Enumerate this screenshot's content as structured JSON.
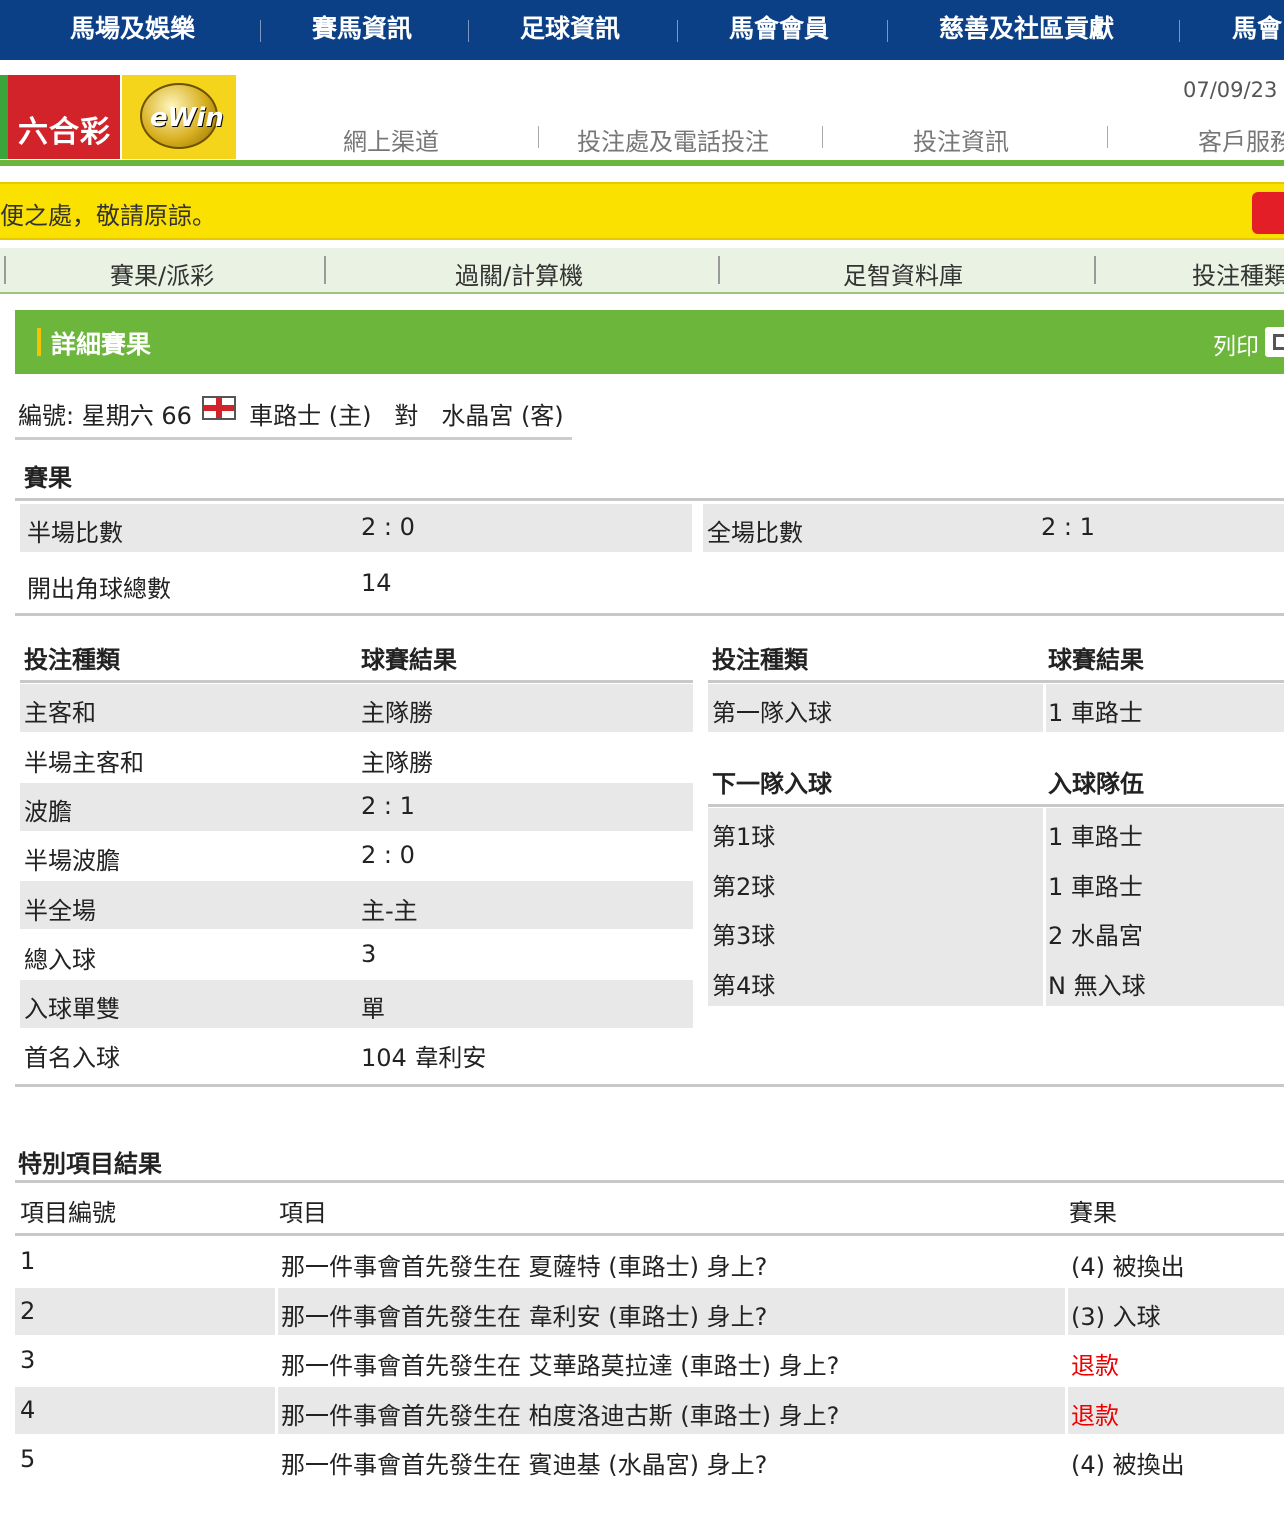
{
  "top_nav": [
    "馬場及娛樂",
    "賽馬資訊",
    "足球資訊",
    "馬會會員",
    "慈善及社區貢獻",
    "馬會"
  ],
  "header": {
    "logo_marksix": "六合彩",
    "logo_ewin": "eWin",
    "date": "07/09/23",
    "sub_nav": [
      "網上渠道",
      "投注處及電話投注",
      "投注資訊",
      "客戶服務"
    ]
  },
  "notice": "便之處，敬請原諒。",
  "tabs": [
    "賽果/派彩",
    "過關/計算機",
    "足智資料庫",
    "投注種類"
  ],
  "section": {
    "title": "詳細賽果",
    "print_label": "列印"
  },
  "match": {
    "prefix": "編號: 星期六 66",
    "home": "車路士 (主)",
    "vs": "對",
    "away": "水晶宮 (客)"
  },
  "results": {
    "heading": "賽果",
    "half_time_label": "半場比數",
    "half_time_score": "2 : 0",
    "full_time_label": "全場比數",
    "full_time_score": "2 : 1",
    "corners_label": "開出角球總數",
    "corners_value": "14"
  },
  "bet_table": {
    "col_type": "投注種類",
    "col_result": "球賽結果",
    "rows": [
      {
        "type": "主客和",
        "result": "主隊勝"
      },
      {
        "type": "半場主客和",
        "result": "主隊勝"
      },
      {
        "type": "波膽",
        "result": "2 : 1"
      },
      {
        "type": "半場波膽",
        "result": "2 : 0"
      },
      {
        "type": "半全場",
        "result": "主-主"
      },
      {
        "type": "總入球",
        "result": "3"
      },
      {
        "type": "入球單雙",
        "result": "單"
      },
      {
        "type": "首名入球",
        "result": "104 韋利安"
      }
    ]
  },
  "right_table": {
    "col_type": "投注種類",
    "col_result": "球賽結果",
    "first_team_label": "第一隊入球",
    "first_team_result": "1 車路士",
    "next_team_heading": "下一隊入球",
    "next_team_col": "入球隊伍",
    "goals": [
      {
        "label": "第1球",
        "team": "1 車路士"
      },
      {
        "label": "第2球",
        "team": "1 車路士"
      },
      {
        "label": "第3球",
        "team": "2 水晶宮"
      },
      {
        "label": "第4球",
        "team": "N 無入球"
      }
    ]
  },
  "special": {
    "heading": "特別項目結果",
    "col_no": "項目編號",
    "col_item": "項目",
    "col_result": "賽果",
    "rows": [
      {
        "no": "1",
        "item": "那一件事會首先發生在 夏薩特 (車路士) 身上?",
        "result": "(4) 被換出"
      },
      {
        "no": "2",
        "item": "那一件事會首先發生在 韋利安 (車路士) 身上?",
        "result": "(3) 入球"
      },
      {
        "no": "3",
        "item": "那一件事會首先發生在 艾華路莫拉達 (車路士) 身上?",
        "result": "退款"
      },
      {
        "no": "4",
        "item": "那一件事會首先發生在 柏度洛迪古斯 (車路士) 身上?",
        "result": "退款"
      },
      {
        "no": "5",
        "item": "那一件事會首先發生在 賓迪基 (水晶宮) 身上?",
        "result": "(4) 被換出"
      }
    ]
  },
  "colors": {
    "nav_blue": "#0b3f86",
    "brand_green": "#6bb63b",
    "notice_yellow": "#fbe100",
    "refund_red": "#e00000"
  }
}
